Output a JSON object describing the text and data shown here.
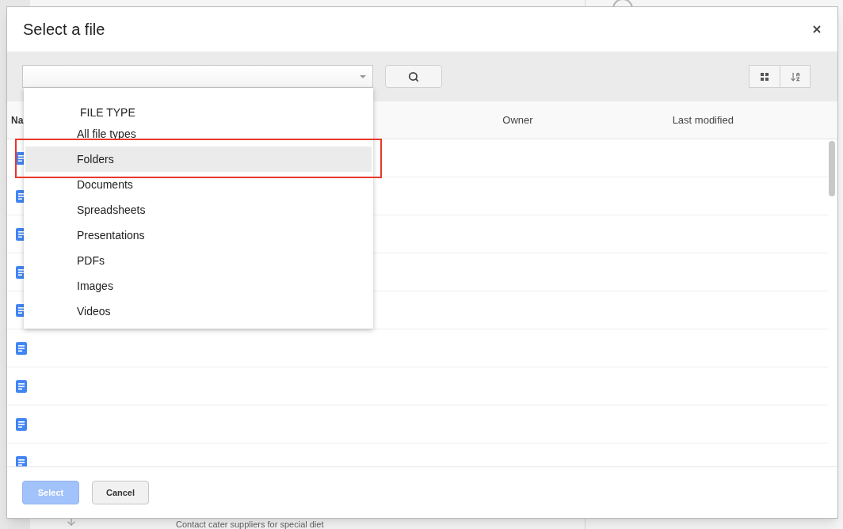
{
  "background_page": {
    "task": "Contact cater suppliers for special diet"
  },
  "dialog": {
    "title": "Select a file",
    "table": {
      "columns": [
        "Na",
        "Owner",
        "Last modified"
      ],
      "rows": [
        {
          "kind": "document"
        },
        {
          "kind": "document"
        },
        {
          "kind": "document"
        },
        {
          "kind": "document"
        },
        {
          "kind": "document"
        },
        {
          "kind": "document"
        },
        {
          "kind": "document"
        },
        {
          "kind": "document"
        },
        {
          "kind": "document"
        }
      ]
    },
    "dropdown": {
      "header": "FILE TYPE",
      "items": [
        {
          "label": "All file types",
          "selected": false,
          "outlined": false
        },
        {
          "label": "Folders",
          "selected": true,
          "outlined": true
        },
        {
          "label": "Documents",
          "selected": false,
          "outlined": false
        },
        {
          "label": "Spreadsheets",
          "selected": false,
          "outlined": false
        },
        {
          "label": "Presentations",
          "selected": false,
          "outlined": false
        },
        {
          "label": "PDFs",
          "selected": false,
          "outlined": false
        },
        {
          "label": "Images",
          "selected": false,
          "outlined": false
        },
        {
          "label": "Videos",
          "selected": false,
          "outlined": false
        }
      ]
    },
    "buttons": [
      {
        "label": "Select",
        "disabled": true
      },
      {
        "label": "Cancel",
        "disabled": false
      }
    ]
  }
}
